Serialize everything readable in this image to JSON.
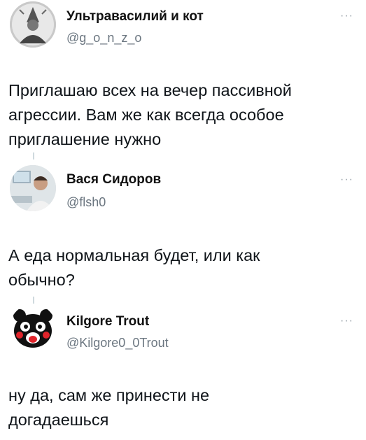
{
  "tweets": [
    {
      "display_name": "Ультравасилий и кот",
      "handle": "@g_o_n_z_o",
      "text": "Приглашаю всех на вечер пассивной агрессии. Вам же как всегда особое приглашение нужно",
      "more_icon": "more-icon"
    },
    {
      "display_name": "Вася Сидоров",
      "handle": "@flsh0",
      "text": "А еда нормальная будет, или как обычно?",
      "more_icon": "more-icon"
    },
    {
      "display_name": "Kilgore Trout",
      "handle": "@Kilgore0_0Trout",
      "text": "ну да, сам же принести не догадаешься",
      "more_icon": "more-icon"
    }
  ],
  "colors": {
    "text": "#0f1419",
    "handle": "#6b7680",
    "thread_line": "#cfd9de"
  }
}
